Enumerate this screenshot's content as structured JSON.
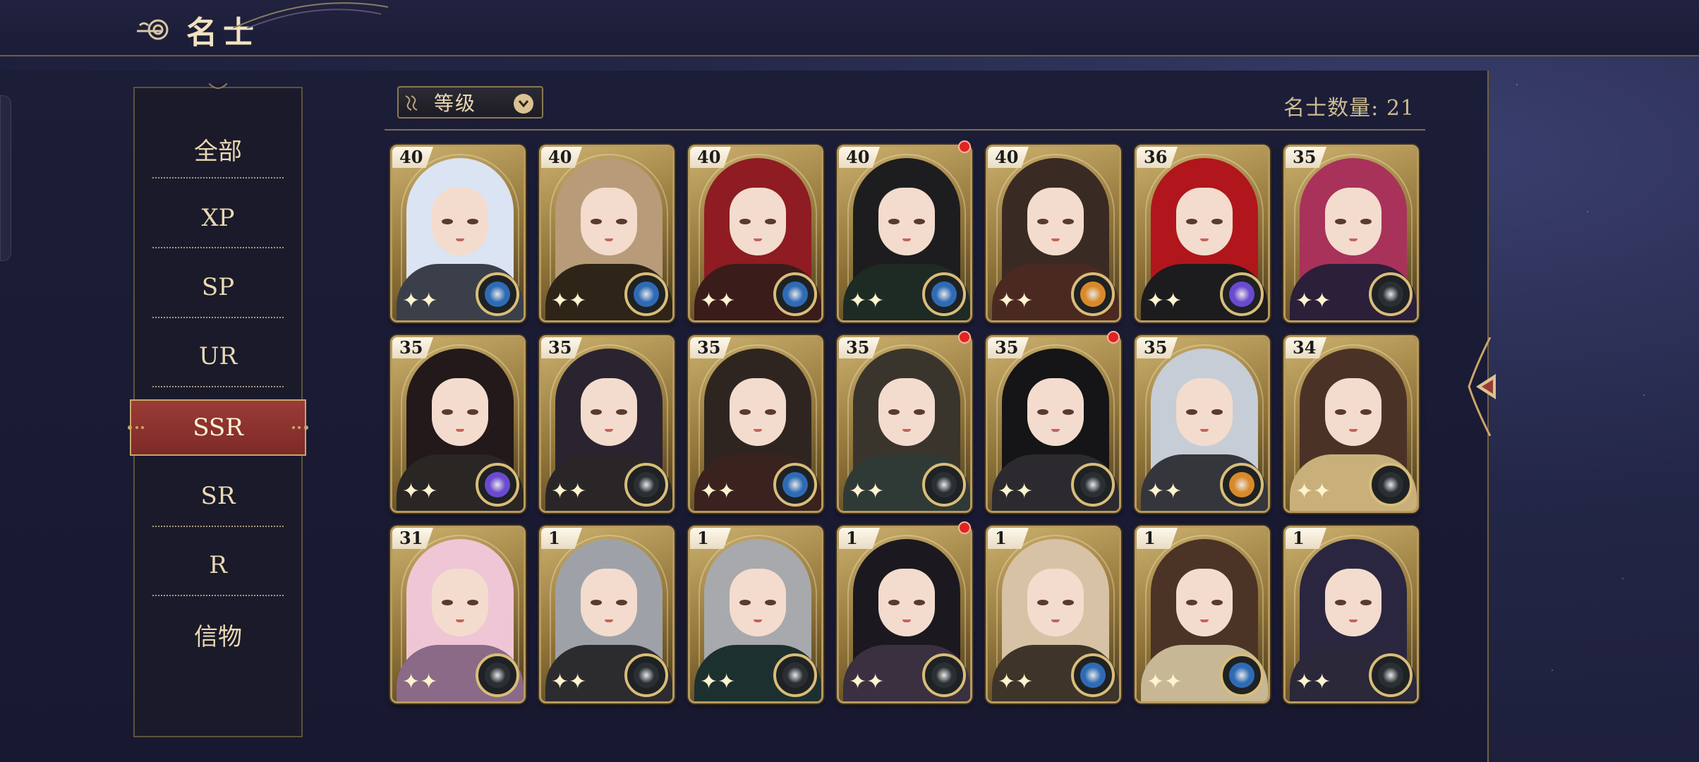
{
  "header": {
    "title": "名士"
  },
  "categories": [
    {
      "label": "全部",
      "active": false
    },
    {
      "label": "XP",
      "active": false
    },
    {
      "label": "SP",
      "active": false
    },
    {
      "label": "UR",
      "active": false
    },
    {
      "label": "SSR",
      "active": true
    },
    {
      "label": "SR",
      "active": false
    },
    {
      "label": "R",
      "active": false
    },
    {
      "label": "信物",
      "active": false
    }
  ],
  "sort": {
    "label": "等级",
    "icon": "chevron-down-icon"
  },
  "count": {
    "label": "名士数量: 21"
  },
  "cards": [
    {
      "level": "40",
      "attr": "blue",
      "hair": "#dbe4f2",
      "robe": "#3b3f4a",
      "new": false
    },
    {
      "level": "40",
      "attr": "blue",
      "hair": "#b89b78",
      "robe": "#2e2418",
      "new": false
    },
    {
      "level": "40",
      "attr": "blue",
      "hair": "#8e1c22",
      "robe": "#3a1c1a",
      "new": false
    },
    {
      "level": "40",
      "attr": "blue",
      "hair": "#1d1d1f",
      "robe": "#1e2a24",
      "new": true
    },
    {
      "level": "40",
      "attr": "gold",
      "hair": "#3a2a24",
      "robe": "#4a2a20",
      "new": false
    },
    {
      "level": "36",
      "attr": "purple",
      "hair": "#b1161c",
      "robe": "#1c1b1d",
      "new": false
    },
    {
      "level": "35",
      "attr": "dark",
      "hair": "#a8325a",
      "robe": "#2b1f3a",
      "new": false
    },
    {
      "level": "35",
      "attr": "purple",
      "hair": "#23181a",
      "robe": "#2a2624",
      "new": false
    },
    {
      "level": "35",
      "attr": "dark",
      "hair": "#2a2430",
      "robe": "#2a2628",
      "new": false
    },
    {
      "level": "35",
      "attr": "blue",
      "hair": "#2f2520",
      "robe": "#3a221e",
      "new": false
    },
    {
      "level": "35",
      "attr": "dark",
      "hair": "#3a352c",
      "robe": "#2f3a36",
      "new": true
    },
    {
      "level": "35",
      "attr": "dark",
      "hair": "#151416",
      "robe": "#2c2a2e",
      "new": true
    },
    {
      "level": "35",
      "attr": "gold",
      "hair": "#c7cdd6",
      "robe": "#34363c",
      "new": false
    },
    {
      "level": "34",
      "attr": "dark",
      "hair": "#4a3326",
      "robe": "#c9b07a",
      "new": false
    },
    {
      "level": "31",
      "attr": "dark",
      "hair": "#efc6d6",
      "robe": "#8a6a86",
      "new": false
    },
    {
      "level": "1",
      "attr": "dark",
      "hair": "#9ea2a8",
      "robe": "#2c2c2f",
      "new": false
    },
    {
      "level": "1",
      "attr": "dark",
      "hair": "#a7a9ad",
      "robe": "#1d3030",
      "new": false
    },
    {
      "level": "1",
      "attr": "dark",
      "hair": "#1b1820",
      "robe": "#3a3040",
      "new": true
    },
    {
      "level": "1",
      "attr": "blue",
      "hair": "#d8c2a6",
      "robe": "#3e342a",
      "new": false
    },
    {
      "level": "1",
      "attr": "blue",
      "hair": "#4b3326",
      "robe": "#c7b794",
      "new": false
    },
    {
      "level": "1",
      "attr": "dark",
      "hair": "#2a2640",
      "robe": "#2b283a",
      "new": false
    }
  ],
  "colors": {
    "accent_gold": "#b99a5d",
    "active_tab": "#9b3b36",
    "attr_blue": "#2f6bb5",
    "attr_gold": "#d88a2a",
    "attr_purple": "#6a4ad0",
    "attr_dark": "#2a2f33"
  }
}
